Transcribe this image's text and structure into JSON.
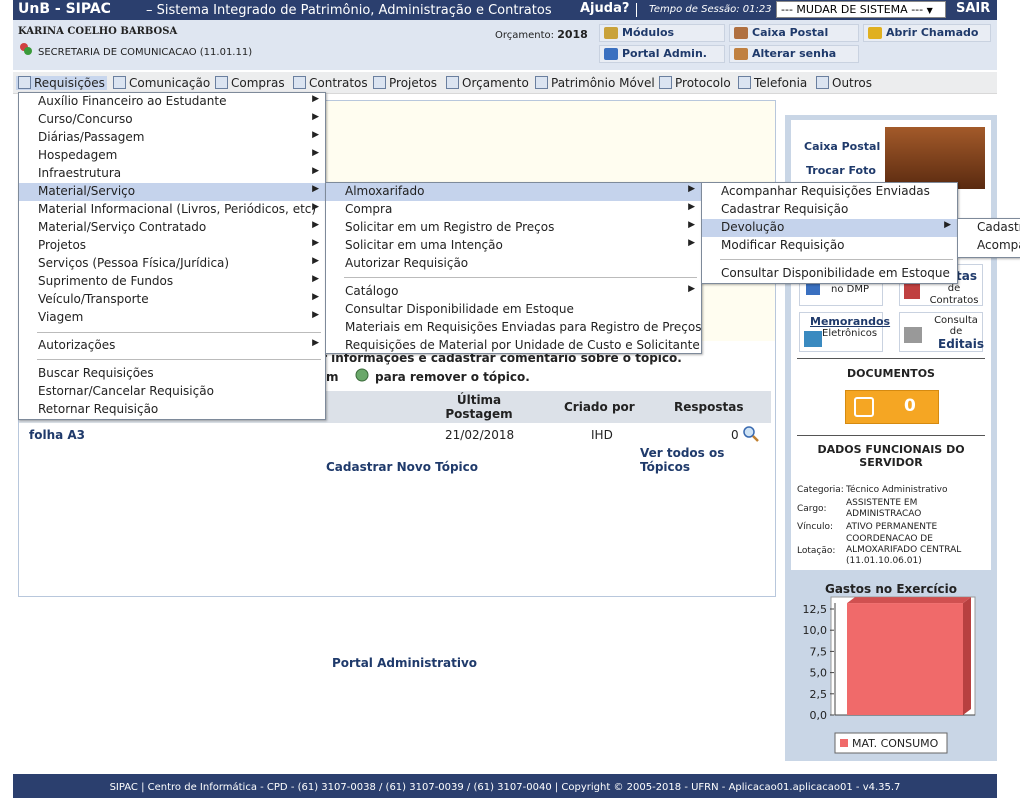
{
  "header": {
    "brand": "UnB - SIPAC",
    "system_title": "– Sistema Integrado de Patrimônio, Administração e Contratos",
    "help": "Ajuda?",
    "session_label": "Tempo de Sessão: 01:23",
    "change_system": "--- MUDAR DE SISTEMA ---",
    "logout": "SAIR"
  },
  "user": {
    "name": "KARINA COELHO BARBOSA",
    "department": "SECRETARIA DE COMUNICACAO (11.01.11)",
    "budget_label": "Orçamento:",
    "budget_year": "2018",
    "buttons": [
      "Módulos",
      "Caixa Postal",
      "Abrir Chamado",
      "Portal Admin.",
      "Alterar senha"
    ]
  },
  "menubar": [
    "Requisições",
    "Comunicação",
    "Compras",
    "Contratos",
    "Projetos",
    "Orçamento",
    "Patrimônio Móvel",
    "Protocolo",
    "Telefonia",
    "Outros"
  ],
  "menu_requisicoes": {
    "items": [
      "Auxílio Financeiro ao Estudante",
      "Curso/Concurso",
      "Diárias/Passagem",
      "Hospedagem",
      "Infraestrutura",
      "Material/Serviço",
      "Material Informacional (Livros, Periódicos, etc)",
      "Material/Serviço Contratado",
      "Projetos",
      "Serviços (Pessoa Física/Jurídica)",
      "Suprimento de Fundos",
      "Veículo/Transporte",
      "Viagem",
      "Autorizações",
      "Buscar Requisições",
      "Estornar/Cancelar Requisição",
      "Retornar Requisição"
    ]
  },
  "menu_material": {
    "items": [
      "Almoxarifado",
      "Compra",
      "Solicitar em um Registro de Preços",
      "Solicitar em uma Intenção",
      "Autorizar Requisição",
      "Catálogo",
      "Consultar Disponibilidade em Estoque",
      "Materiais em Requisições Enviadas para Registro de Preços",
      "Requisições de Material por Unidade de Custo e Solicitante"
    ]
  },
  "menu_almoxarifado": {
    "items": [
      "Acompanhar Requisições Enviadas",
      "Cadastrar Requisição",
      "Devolução",
      "Modificar Requisição",
      "Consultar Disponibilidade em Estoque"
    ]
  },
  "menu_devolucao": {
    "items": [
      "Cadastr",
      "Acompa"
    ]
  },
  "forum": {
    "info_line1": "r informações e cadastrar comentário sobre o tópico.",
    "info_line2_a": "m",
    "info_line2_b": "para remover o tópico.",
    "col_last_post": "Última Postagem",
    "col_created_by": "Criado por",
    "col_replies": "Respostas",
    "row_topic": "folha A3",
    "row_date": "21/02/2018",
    "row_author": "IHD",
    "row_replies": "0",
    "see_all": "Ver todos os Tópicos",
    "new_topic": "Cadastrar Novo Tópico"
  },
  "portal_admin_link": "Portal Administrativo",
  "sidebar": {
    "mailbox": "Caixa Postal",
    "change_photo": "Trocar Foto",
    "dmp": "Processamento no DMP",
    "contracts_top": "tas",
    "contracts": "de Contratos",
    "memos": "Memorandos",
    "memos2": "Eletrônicos",
    "consulta": "Consulta de",
    "editais": "Editais",
    "documents_title": "DOCUMENTOS",
    "documents_count": "0",
    "dados_title": "DADOS FUNCIONAIS DO SERVIDOR",
    "categoria_label": "Categoria:",
    "categoria_value": "Técnico Administrativo",
    "cargo_label": "Cargo:",
    "cargo_value": "ASSISTENTE EM ADMINISTRACAO",
    "vinculo_label": "Vínculo:",
    "vinculo_value": "ATIVO PERMANENTE",
    "lotacao_label": "Lotação:",
    "lotacao_value": "COORDENACAO DE ALMOXARIFADO CENTRAL (11.01.10.06.01)",
    "gastos_title": "Gastos no Exercício"
  },
  "chart_data": {
    "type": "bar",
    "title": "Gastos no Exercício",
    "categories": [
      "MAT. CONSUMO"
    ],
    "values": [
      13.2
    ],
    "ylim": [
      0,
      12.5
    ],
    "yticks": [
      "12,5",
      "10,0",
      "7,5",
      "5,0",
      "2,5",
      "0,0"
    ],
    "series": [
      {
        "name": "MAT. CONSUMO",
        "values": [
          13.2
        ]
      }
    ],
    "legend": "bottom",
    "colors": {
      "bar": "#f06a6a"
    }
  },
  "footer": "SIPAC | Centro de Informática - CPD - (61) 3107-0038 / (61) 3107-0039 / (61) 3107-0040 | Copyright © 2005-2018 - UFRN - Aplicacao01.aplicacao01 - v4.35.7"
}
